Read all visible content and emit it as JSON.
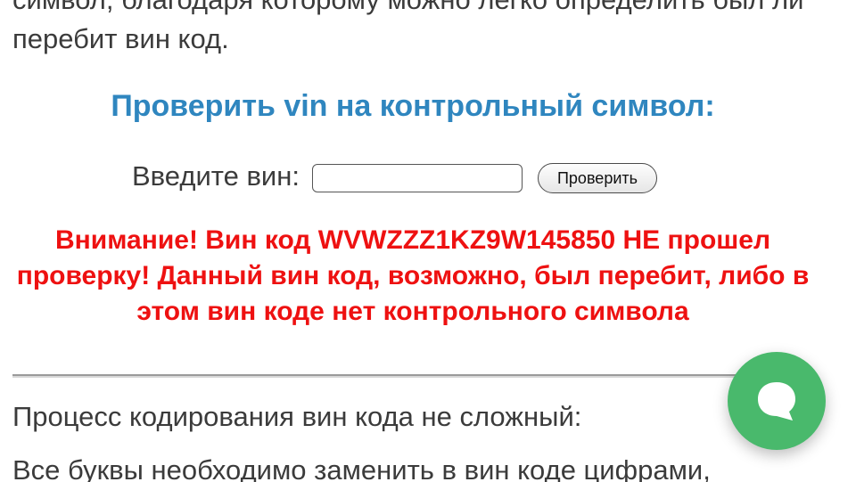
{
  "article": {
    "intro_text": "символ, благодаря которому можно легко определить был ли перебит вин код.",
    "check_title": "Проверить vin на контрольный символ:",
    "form": {
      "label": "Введите вин:",
      "input_value": "",
      "button_label": "Проверить"
    },
    "warning_text": "Внимание! Вин код WVWZZZ1KZ9W145850 НЕ прошел проверку! Данный вин код, возможно, был перебит, либо в этом вин коде нет контрольного символа",
    "paragraph_1": "Процесс кодирования вин кода не сложный:",
    "paragraph_2": "Все буквы необходимо заменить в вин коде цифрами,"
  },
  "chat": {
    "icon": "chat-bubble-icon",
    "color": "#49b96c"
  },
  "colors": {
    "title": "#2f86bf",
    "warning": "#ee1111",
    "text": "#3b3b3b"
  }
}
